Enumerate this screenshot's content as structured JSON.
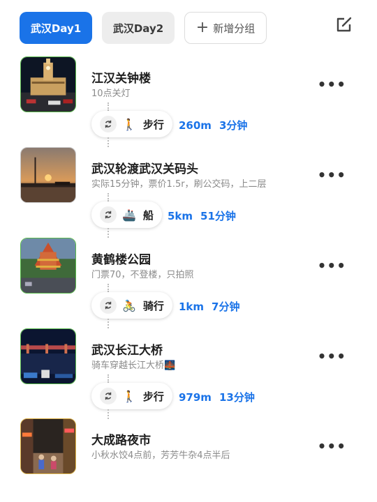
{
  "tabs": [
    {
      "label": "武汉Day1",
      "active": true
    },
    {
      "label": "武汉Day2",
      "active": false
    }
  ],
  "add_group_label": "新增分组",
  "stops": [
    {
      "title": "江汉关钟楼",
      "note": "10点关灯"
    },
    {
      "title": "武汉轮渡武汉关码头",
      "note": "实际15分钟，票价1.5r，刷公交码，上二层"
    },
    {
      "title": "黄鹤楼公园",
      "note": "门票70，不登楼，只拍照"
    },
    {
      "title": "武汉长江大桥",
      "note": "骑车穿越长江大桥🌉"
    },
    {
      "title": "大成路夜市",
      "note": "小秋水饺4点前，芳芳牛杂4点半后"
    }
  ],
  "legs": [
    {
      "mode": "步行",
      "mode_icon": "walking-person",
      "distance": "260m",
      "duration": "3分钟"
    },
    {
      "mode": "船",
      "mode_icon": "ship",
      "distance": "5km",
      "duration": "51分钟"
    },
    {
      "mode": "骑行",
      "mode_icon": "cyclist",
      "distance": "1km",
      "duration": "7分钟"
    },
    {
      "mode": "步行",
      "mode_icon": "walking-person",
      "distance": "979m",
      "duration": "13分钟"
    }
  ],
  "more_label": "•••",
  "colors": {
    "accent": "#1a73e8",
    "tab_inactive": "#ededed",
    "note": "#8a8a8a"
  }
}
